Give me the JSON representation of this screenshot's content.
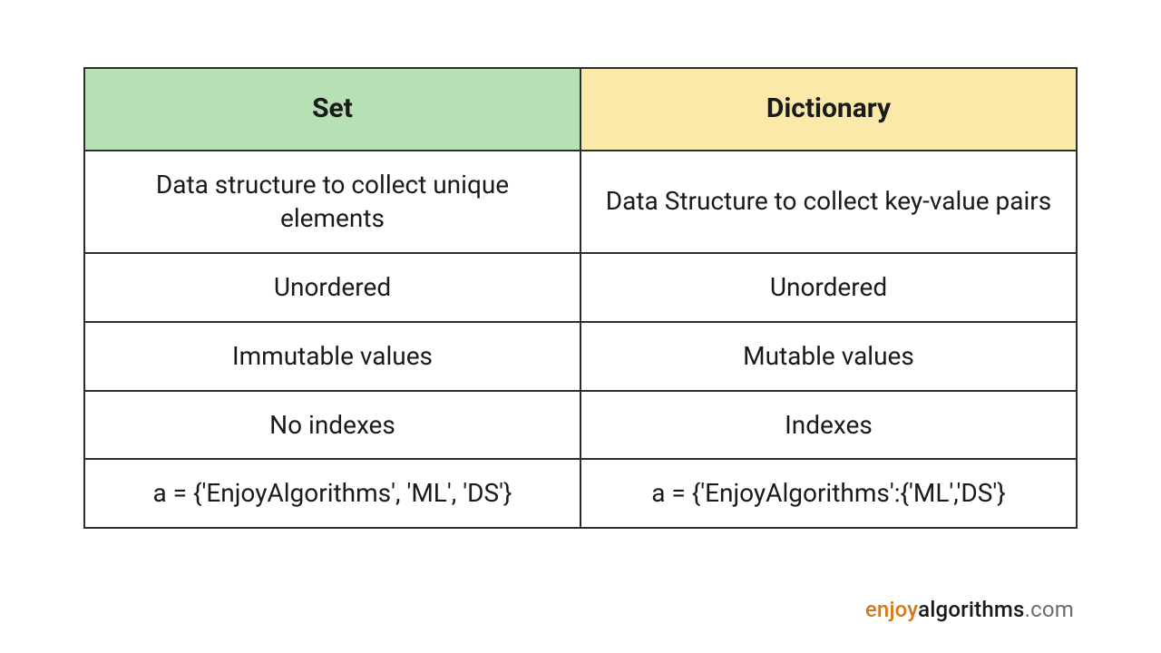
{
  "chart_data": {
    "type": "table",
    "columns": [
      "Set",
      "Dictionary"
    ],
    "rows": [
      [
        "Data structure to collect unique elements",
        "Data Structure to collect key-value pairs"
      ],
      [
        "Unordered",
        "Unordered"
      ],
      [
        "Immutable values",
        "Mutable values"
      ],
      [
        "No indexes",
        "Indexes"
      ],
      [
        "a = {'EnjoyAlgorithms', 'ML', 'DS'}",
        "a = {'EnjoyAlgorithms':{'ML','DS'}"
      ]
    ]
  },
  "table": {
    "headers": {
      "left": "Set",
      "right": "Dictionary"
    },
    "rows": [
      {
        "left": "Data structure to collect unique elements",
        "right": "Data Structure to collect key-value pairs"
      },
      {
        "left": "Unordered",
        "right": "Unordered"
      },
      {
        "left": "Immutable values",
        "right": "Mutable values"
      },
      {
        "left": "No indexes",
        "right": "Indexes"
      },
      {
        "left": "a = {'EnjoyAlgorithms', 'ML', 'DS'}",
        "right": "a = {'EnjoyAlgorithms':{'ML','DS'}"
      }
    ]
  },
  "watermark": {
    "part1": "enjoy",
    "part2": "algorithms",
    "tld": ".com"
  }
}
